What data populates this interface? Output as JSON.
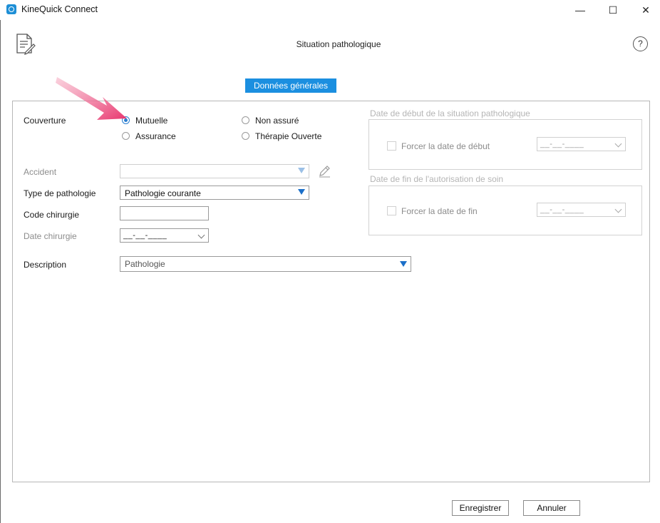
{
  "window": {
    "title": "KineQuick Connect",
    "minimize": "—",
    "maximize": "☐",
    "close": "✕"
  },
  "header": {
    "title": "Situation pathologique",
    "help": "?"
  },
  "tabs": [
    {
      "label": "Données générales",
      "active": true
    }
  ],
  "form": {
    "couverture_label": "Couverture",
    "coverage_options": [
      {
        "label": "Mutuelle",
        "checked": true
      },
      {
        "label": "Non assuré",
        "checked": false
      },
      {
        "label": "Assurance",
        "checked": false
      },
      {
        "label": "Thérapie Ouverte",
        "checked": false
      }
    ],
    "accident_label": "Accident",
    "accident_value": "",
    "type_pathologie_label": "Type de pathologie",
    "type_pathologie_value": "Pathologie courante",
    "code_chirurgie_label": "Code chirurgie",
    "code_chirurgie_value": "",
    "date_chirurgie_label": "Date chirurgie",
    "date_chirurgie_value": "__-__-____",
    "description_label": "Description",
    "description_value": "Pathologie"
  },
  "start_group": {
    "title": "Date de début de la situation pathologique",
    "checkbox_label": "Forcer la date de début",
    "checked": false,
    "date_value": "__-__-____"
  },
  "end_group": {
    "title": "Date de fin de l'autorisation de soin",
    "checkbox_label": "Forcer la date de fin",
    "checked": false,
    "date_value": "__-__-____"
  },
  "footer": {
    "save_label": "Enregistrer",
    "cancel_label": "Annuler"
  },
  "colors": {
    "accent": "#1b8fe0",
    "annotation_arrow": "#e8356e"
  }
}
